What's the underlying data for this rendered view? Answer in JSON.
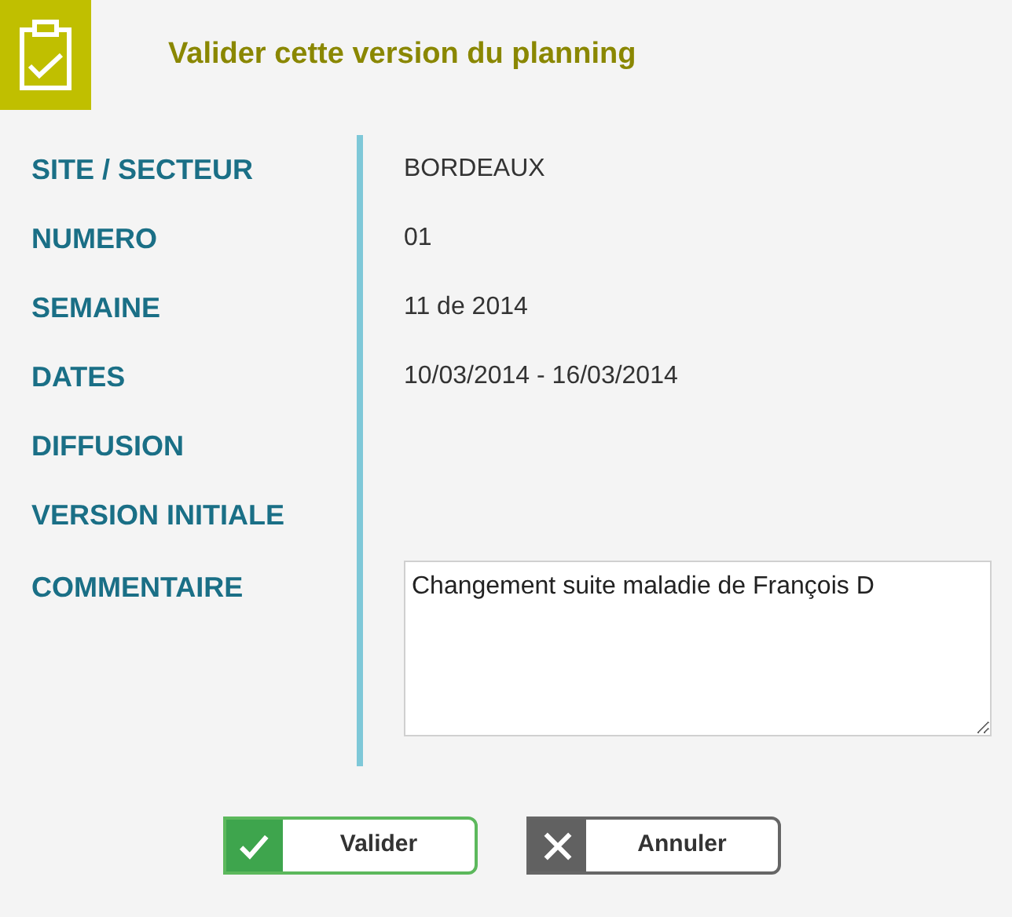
{
  "dialog": {
    "title": "Valider cette version du planning"
  },
  "fields": [
    {
      "label": "SITE / SECTEUR",
      "kind": "text",
      "value": "BORDEAUX"
    },
    {
      "label": "NUMERO",
      "kind": "text",
      "value": "01"
    },
    {
      "label": "SEMAINE",
      "kind": "text",
      "value": "11 de 2014"
    },
    {
      "label": "DATES",
      "kind": "text",
      "value": "10/03/2014 - 16/03/2014"
    },
    {
      "label": "DIFFUSION",
      "kind": "text"
    },
    {
      "label": "VERSION INITIALE",
      "kind": "text"
    },
    {
      "label": "COMMENTAIRE",
      "kind": "textarea",
      "value": "Changement suite maladie de François D"
    }
  ],
  "buttons": [
    {
      "label": "Valider",
      "kind": "confirm"
    },
    {
      "label": "Annuler",
      "kind": "cancel"
    }
  ]
}
